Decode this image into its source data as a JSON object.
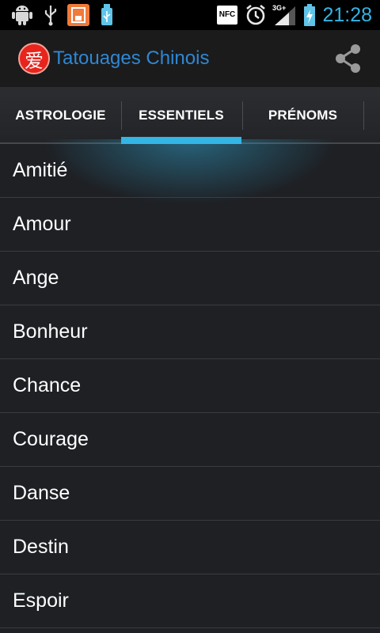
{
  "status_bar": {
    "icons": [
      "android-icon",
      "usb-icon",
      "save-icon",
      "usb-storage-icon",
      "nfc-icon",
      "alarm-icon",
      "signal-3g-icon",
      "battery-charging-icon"
    ],
    "nfc_label": "NFC",
    "network_label": "3G+",
    "time": "21:28",
    "accent_color": "#33b5e5"
  },
  "action_bar": {
    "logo_glyph": "爱",
    "title": "Tatouages Chinois",
    "title_color": "#2f87d4",
    "share_icon": "share-icon"
  },
  "tabs": [
    {
      "label": "ASTROLOGIE",
      "selected": false
    },
    {
      "label": "ESSENTIELS",
      "selected": true
    },
    {
      "label": "PRÉNOMS",
      "selected": false
    }
  ],
  "list": {
    "items": [
      "Amitié",
      "Amour",
      "Ange",
      "Bonheur",
      "Chance",
      "Courage",
      "Danse",
      "Destin",
      "Espoir"
    ]
  }
}
